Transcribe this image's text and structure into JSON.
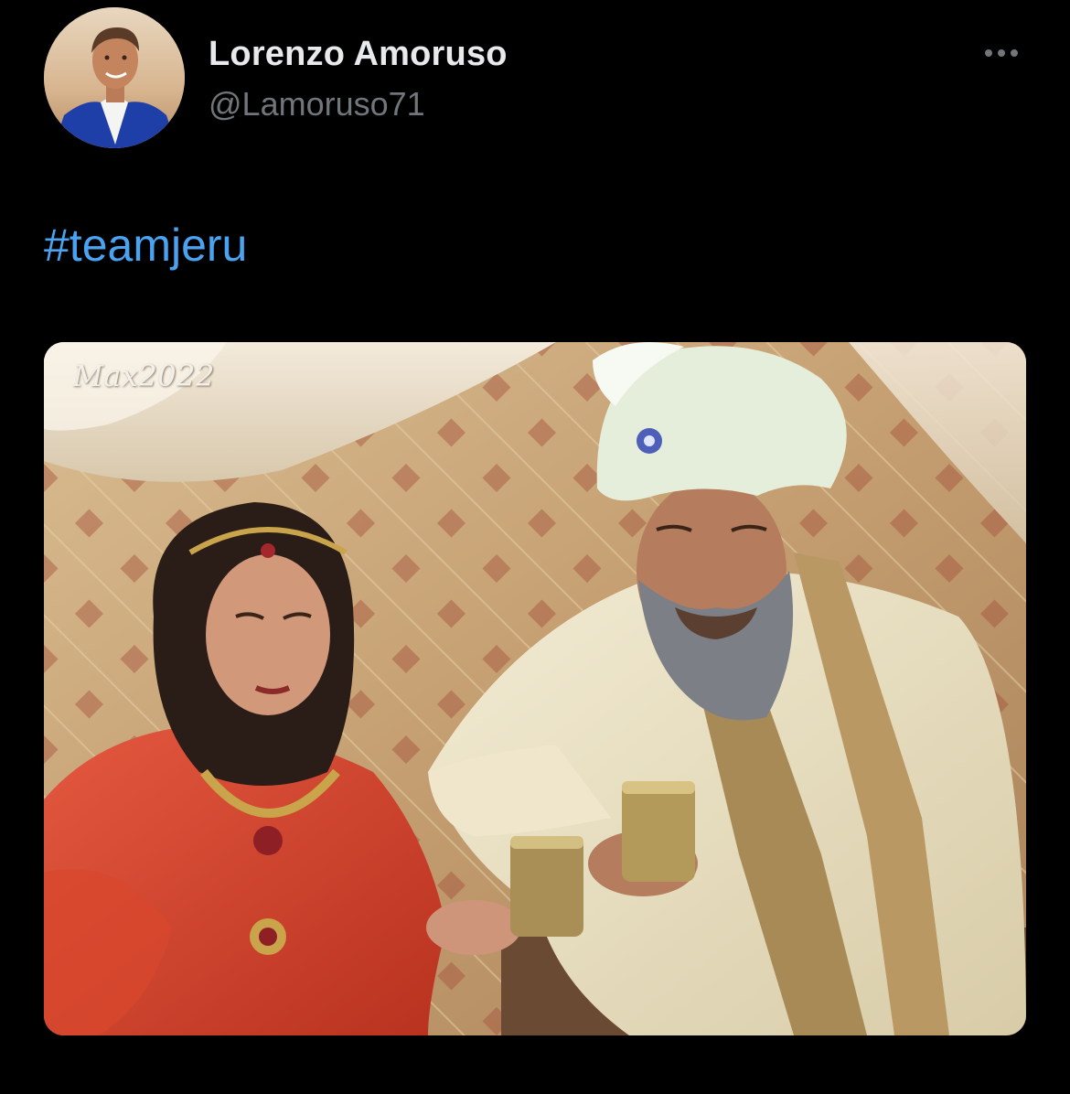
{
  "author": {
    "display_name": "Lorenzo Amoruso",
    "handle": "@Lamoruso71",
    "avatar_icon": "profile-photo-avatar"
  },
  "tweet": {
    "hashtag": "#teamjeru"
  },
  "media": {
    "watermark": "Max2022",
    "description_icon": "photo-image"
  },
  "actions": {
    "more_icon": "more-horizontal-icon"
  },
  "colors": {
    "background": "#000000",
    "name": "#e7e9ea",
    "handle": "#71767b",
    "link": "#4aa3f0"
  }
}
